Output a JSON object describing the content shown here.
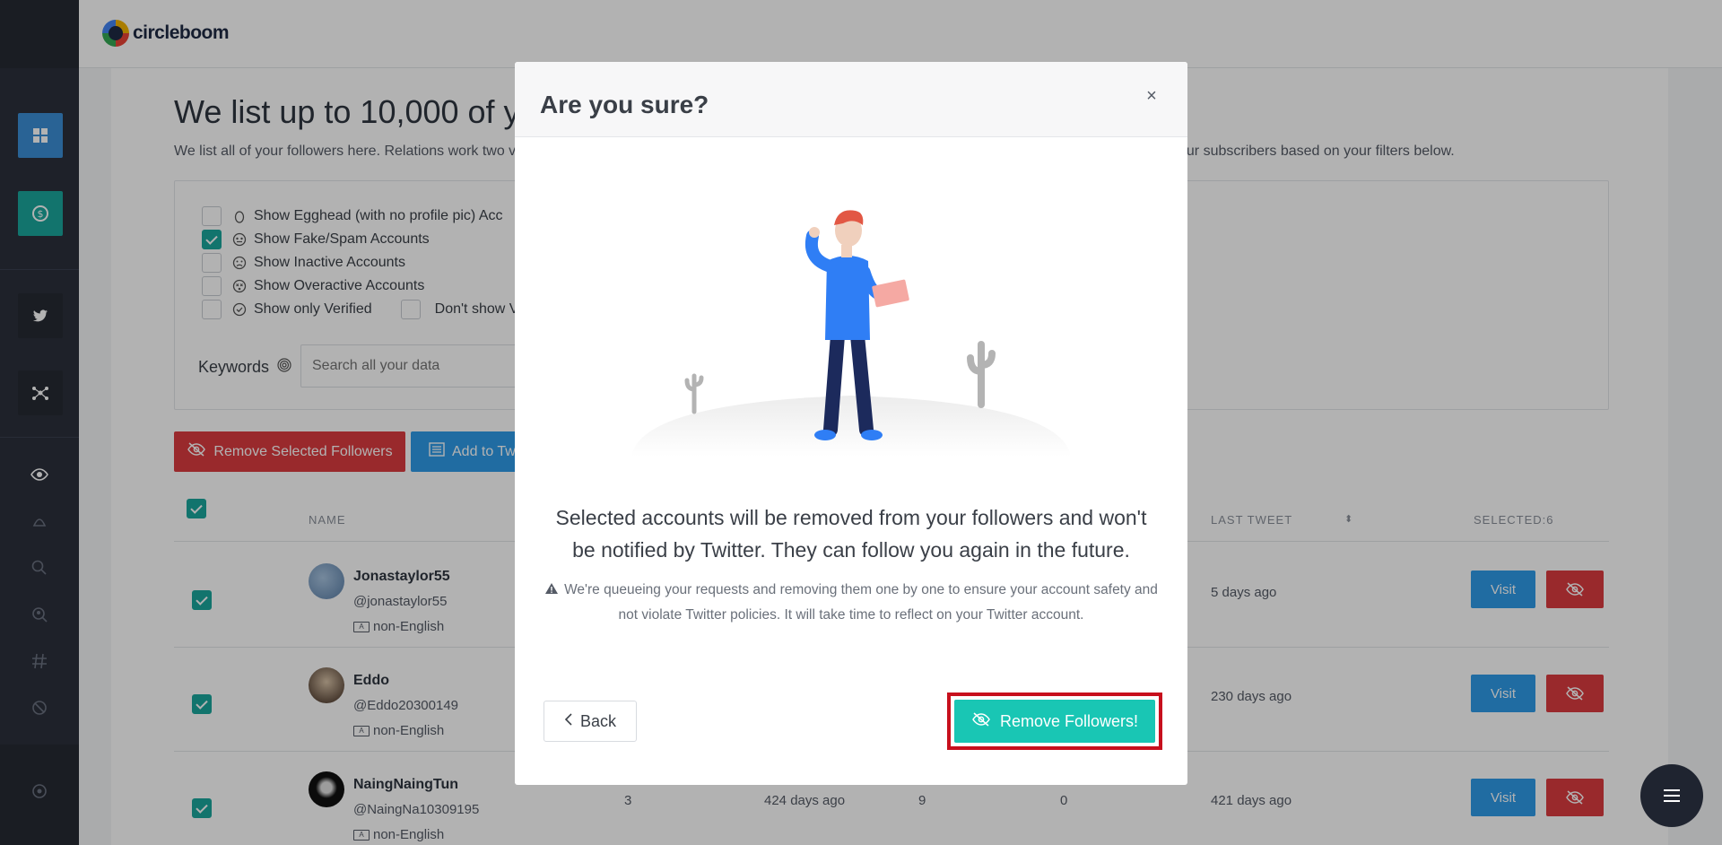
{
  "brand": {
    "name": "circleboom"
  },
  "page": {
    "title": "We list up to 10,000 of yo",
    "description": "We list all of your followers here. Relations work two v",
    "description_right": "our subscribers based on your filters below."
  },
  "filters": {
    "items": [
      {
        "label": "Show Egghead (with no profile pic) Acc",
        "checked": false
      },
      {
        "label": "Show Fake/Spam Accounts",
        "checked": true
      },
      {
        "label": "Show Inactive Accounts",
        "checked": false
      },
      {
        "label": "Show Overactive Accounts",
        "checked": false
      },
      {
        "label": "Show only Verified",
        "checked": false
      }
    ],
    "dont_show_label": "Don't show V",
    "keywords_label": "Keywords",
    "search_placeholder": "Search all your data"
  },
  "actions": {
    "remove_selected": "Remove Selected Followers",
    "add_to_list": "Add to Twi"
  },
  "table": {
    "headers": {
      "name": "NAME",
      "last_tweet": "LAST TWEET",
      "selected": "SELECTED:6"
    },
    "rows": [
      {
        "name": "Jonastaylor55",
        "handle": "@jonastaylor55",
        "lang": "non-English",
        "c1": "",
        "c2": "",
        "c3": "",
        "c4": "",
        "last_tweet": "5 days ago"
      },
      {
        "name": "Eddo",
        "handle": "@Eddo20300149",
        "lang": "non-English",
        "c1": "",
        "c2": "",
        "c3": "",
        "c4": "",
        "last_tweet": "230 days ago"
      },
      {
        "name": "NaingNaingTun",
        "handle": "@NaingNa10309195",
        "lang": "non-English",
        "c1": "3",
        "c2": "424 days ago",
        "c3": "9",
        "c4": "0",
        "last_tweet": "421 days ago"
      }
    ],
    "visit_label": "Visit"
  },
  "modal": {
    "title": "Are you sure?",
    "close": "×",
    "message": "Selected accounts will be removed from your followers and won't be notified by Twitter. They can follow you again in the future.",
    "note": "We're queueing your requests and removing them one by one to ensure your account safety and not violate Twitter policies. It will take time to reflect on your Twitter account.",
    "back_label": "Back",
    "confirm_label": "Remove Followers!"
  },
  "colors": {
    "sidebar": "#2b303b",
    "accent_blue": "#2f9be8",
    "accent_teal": "#1aa79c",
    "danger": "#dc3b3f",
    "confirm": "#19c6b4",
    "highlight": "#c7101d"
  }
}
